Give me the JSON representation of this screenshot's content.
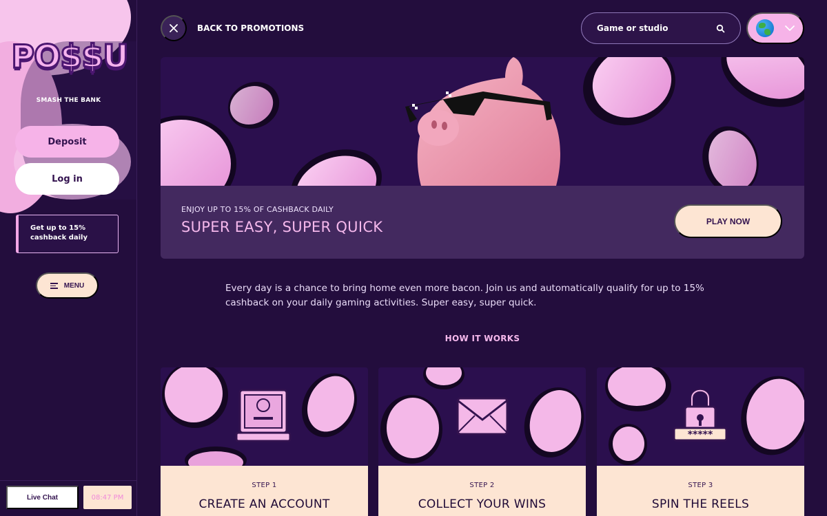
{
  "sidebar": {
    "logo_text": "PO$$U",
    "tagline": "SMASH THE BANK",
    "deposit_label": "Deposit",
    "login_label": "Log in",
    "promo_line1": "Get up to 15%",
    "promo_line2": "cashback daily",
    "menu_label": "MENU",
    "menu_icon": "hamburger-icon",
    "live_chat_label": "Live Chat",
    "clock_time": "08:47 PM"
  },
  "header": {
    "close_icon": "close-icon",
    "back_label": "BACK TO PROMOTIONS",
    "search_placeholder": "Game or studio",
    "search_icon": "search-icon",
    "language_icon": "globe-icon",
    "language_chevron": "chevron-down-icon"
  },
  "hero": {
    "eyebrow": "ENJOY UP TO 15% OF CASHBACK DAILY",
    "title": "SUPER EASY, SUPER QUICK",
    "play_label": "PLAY NOW"
  },
  "intro_text": "Every day is a chance to bring home even more bacon. Join us and automatically qualify for up to 15% cashback on your daily gaming activities. Super easy, super quick.",
  "how_it_works": "HOW IT WORKS",
  "steps": [
    {
      "number": "STEP 1",
      "title": "CREATE AN ACCOUNT",
      "icon": "account-icon"
    },
    {
      "number": "STEP 2",
      "title": "COLLECT YOUR WINS",
      "icon": "envelope-icon"
    },
    {
      "number": "STEP 3",
      "title": "SPIN THE REELS",
      "icon": "lock-icon"
    }
  ],
  "colors": {
    "background": "#230d3d",
    "accent_pink": "#f6b3e8",
    "cream": "#fde5d3",
    "panel": "#43295f"
  }
}
